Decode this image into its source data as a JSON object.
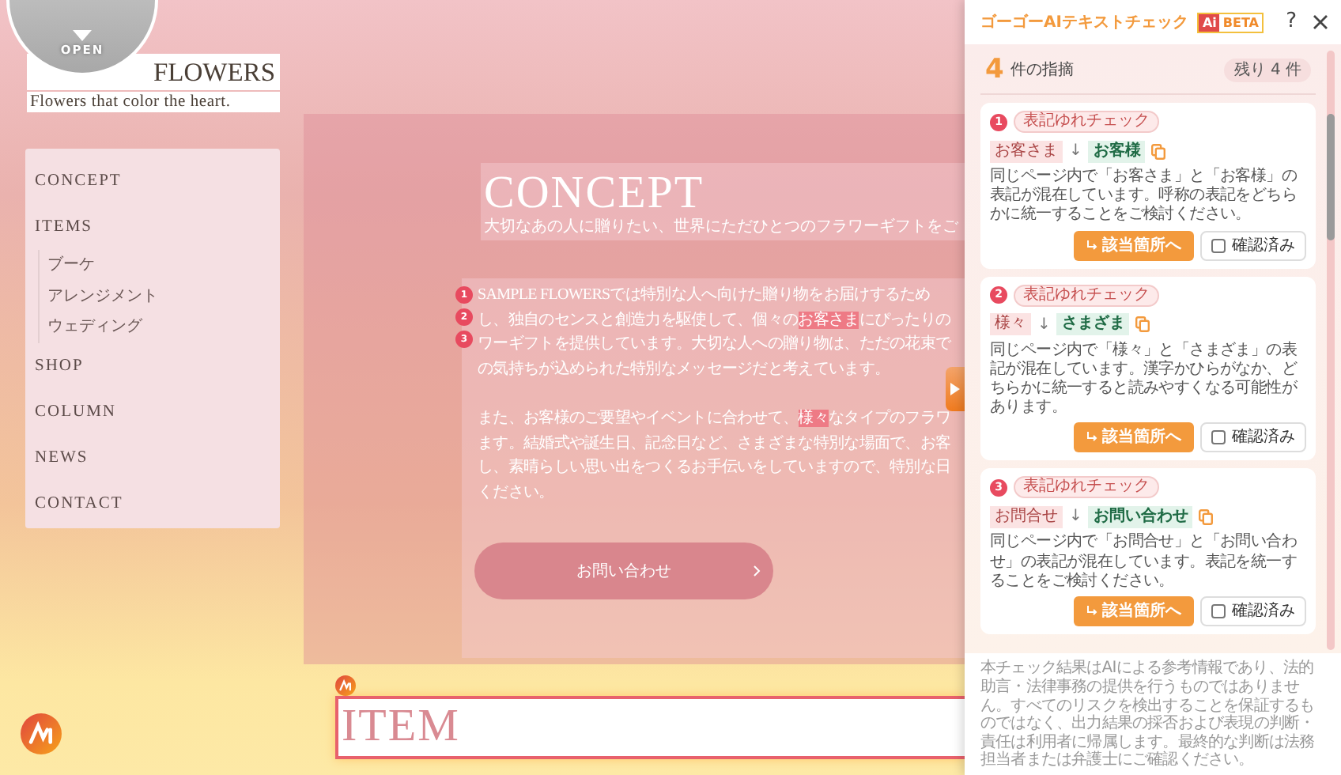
{
  "site": {
    "open_button": {
      "label": "OPEN"
    },
    "logo": {
      "title": "FLOWERS",
      "tagline": "Flowers that color the heart."
    },
    "nav": [
      {
        "label": "CONCEPT"
      },
      {
        "label": "ITEMS",
        "children": [
          {
            "label": "ブーケ"
          },
          {
            "label": "アレンジメント"
          },
          {
            "label": "ウェディング"
          }
        ]
      },
      {
        "label": "SHOP"
      },
      {
        "label": "COLUMN"
      },
      {
        "label": "NEWS"
      },
      {
        "label": "CONTACT"
      }
    ],
    "concept": {
      "title": "CONCEPT",
      "subtitle": "大切なあの人に贈りたい、世界にただひとつのフラワーギフトをご",
      "markers": [
        "1",
        "2",
        "3"
      ],
      "paragraphs": [
        [
          [
            {
              "text": "SAMPLE FLOWERSでは特別な人へ向けた贈り物をお届けするため",
              "highlighted": false
            }
          ],
          [
            {
              "text": "し、独自のセンスと創造力を駆使して、個々の",
              "highlighted": false
            },
            {
              "text": "お客さま",
              "highlighted": true
            },
            {
              "text": "にぴったりの",
              "highlighted": false
            }
          ],
          [
            {
              "text": "ワーギフトを提供しています。大切な人への贈り物は、ただの花束で",
              "highlighted": false
            }
          ],
          [
            {
              "text": "の気持ちが込められた特別なメッセージだと考えています。",
              "highlighted": false
            }
          ]
        ],
        [
          [
            {
              "text": "また、お客様のご要望やイベントに合わせて、",
              "highlighted": false
            },
            {
              "text": "様々",
              "highlighted": true
            },
            {
              "text": "なタイプのフラワ",
              "highlighted": false
            }
          ],
          [
            {
              "text": "ます。結婚式や誕生日、記念日など、さまざまな特別な場面で、お客",
              "highlighted": false
            }
          ],
          [
            {
              "text": "し、素晴らしい思い出をつくるお手伝いをしていますので、特別な日",
              "highlighted": false
            }
          ],
          [
            {
              "text": "ください。",
              "highlighted": false
            }
          ]
        ]
      ],
      "button": "お問い合わせ"
    },
    "next_section": {
      "title": "ITEM"
    }
  },
  "panel": {
    "title": "ゴーゴーAIテキストチェック",
    "badge_logo": "Ai",
    "badge": "BETA",
    "help": "?",
    "count": "4",
    "count_label": "件の指摘",
    "remaining": "残り 4 件",
    "issues": [
      {
        "number": "1",
        "tag": "表記ゆれチェック",
        "original": "お客さま",
        "arrow": "↓",
        "suggestion": "お客様",
        "description": "同じページ内で「お客さま」と「お客様」の表記が混在しています。呼称の表記をどちらかに統一することをご検討ください。",
        "jump_button": "該当箇所へ",
        "confirm": {
          "label": "確認済み",
          "checked": false
        }
      },
      {
        "number": "2",
        "tag": "表記ゆれチェック",
        "original": "様々",
        "arrow": "↓",
        "suggestion": "さまざま",
        "description": "同じページ内で「様々」と「さまざま」の表記が混在しています。漢字かひらがなか、どちらかに統一すると読みやすくなる可能性があります。",
        "jump_button": "該当箇所へ",
        "confirm": {
          "label": "確認済み",
          "checked": false
        }
      },
      {
        "number": "3",
        "tag": "表記ゆれチェック",
        "original": "お問合せ",
        "arrow": "↓",
        "suggestion": "お問い合わせ",
        "description": "同じページ内で「お問合せ」と「お問い合わせ」の表記が混在しています。表記を統一することをご検討ください。",
        "jump_button": "該当箇所へ",
        "confirm": {
          "label": "確認済み",
          "checked": false
        }
      }
    ],
    "disclaimer": "本チェック結果はAIによる参考情報であり、法的助言・法律事務の提供を行うものではありません。すべてのリスクを検出することを保証するものではなく、出力結果の採否および表現の判断・責任は利用者に帰属します。最終的な判断は法務担当者または弁護士にご確認ください。"
  }
}
